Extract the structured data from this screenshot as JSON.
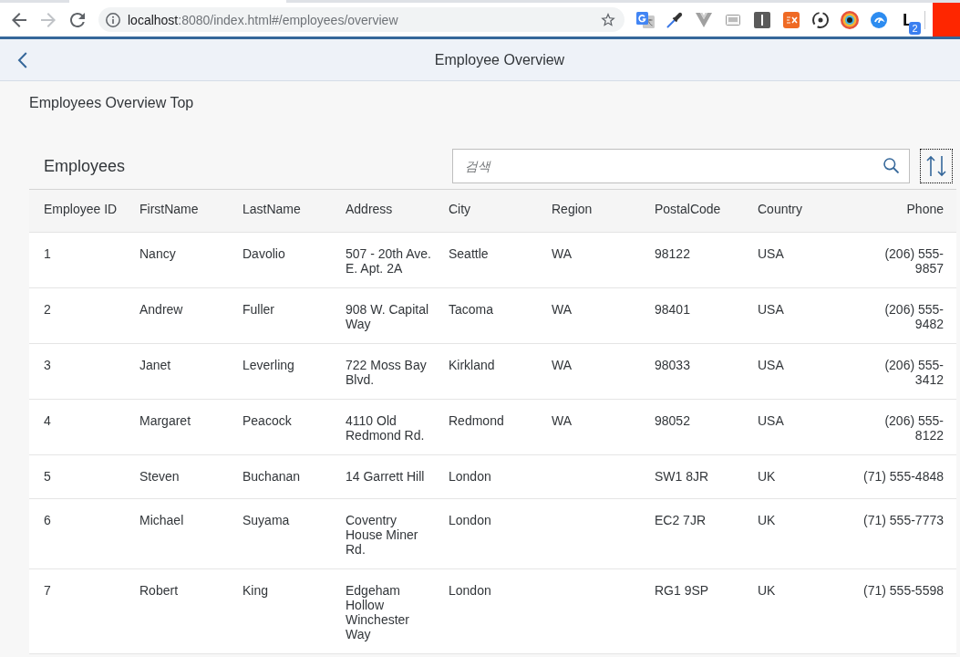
{
  "browser": {
    "nav": [
      {
        "kind": "back",
        "disabled": false
      },
      {
        "kind": "forward",
        "disabled": true
      },
      {
        "kind": "reload",
        "disabled": false
      }
    ],
    "url": {
      "host": "localhost",
      "path": ":8080/index.html#/employees/overview"
    },
    "extensions": [
      {
        "kind": "translate"
      },
      {
        "kind": "dropper"
      },
      {
        "kind": "vee"
      },
      {
        "kind": "screen"
      },
      {
        "kind": "bar"
      },
      {
        "kind": "ex"
      },
      {
        "kind": "sync"
      },
      {
        "kind": "ring"
      },
      {
        "kind": "swirl"
      },
      {
        "kind": "letter",
        "label": "L",
        "badge": "2"
      }
    ]
  },
  "header": {
    "title": "Employee Overview"
  },
  "page": {
    "heading": "Employees Overview Top"
  },
  "table": {
    "title": "Employees",
    "search": {
      "placeholder": "검색"
    },
    "sort_button": {
      "focused": true
    },
    "columns": [
      {
        "label": "Employee ID",
        "kind": "text"
      },
      {
        "label": "FirstName",
        "kind": "text"
      },
      {
        "label": "LastName",
        "kind": "text"
      },
      {
        "label": "Address",
        "kind": "text"
      },
      {
        "label": "City",
        "kind": "text"
      },
      {
        "label": "Region",
        "kind": "text"
      },
      {
        "label": "PostalCode",
        "kind": "text"
      },
      {
        "label": "Country",
        "kind": "text"
      },
      {
        "label": "Phone",
        "kind": "phone"
      }
    ],
    "rows": [
      {
        "id": "1",
        "first_name": "Nancy",
        "last_name": "Davolio",
        "address": "507 - 20th Ave. E. Apt. 2A",
        "city": "Seattle",
        "region": "WA",
        "postal_code": "98122",
        "country": "USA",
        "phone": "(206) 555-9857"
      },
      {
        "id": "2",
        "first_name": "Andrew",
        "last_name": "Fuller",
        "address": "908 W. Capital Way",
        "city": "Tacoma",
        "region": "WA",
        "postal_code": "98401",
        "country": "USA",
        "phone": "(206) 555-9482"
      },
      {
        "id": "3",
        "first_name": "Janet",
        "last_name": "Leverling",
        "address": "722 Moss Bay Blvd.",
        "city": "Kirkland",
        "region": "WA",
        "postal_code": "98033",
        "country": "USA",
        "phone": "(206) 555-3412"
      },
      {
        "id": "4",
        "first_name": "Margaret",
        "last_name": "Peacock",
        "address": "4110 Old Redmond Rd.",
        "city": "Redmond",
        "region": "WA",
        "postal_code": "98052",
        "country": "USA",
        "phone": "(206) 555-8122"
      },
      {
        "id": "5",
        "first_name": "Steven",
        "last_name": "Buchanan",
        "address": "14 Garrett Hill",
        "city": "London",
        "postal_code": "SW1 8JR",
        "country": "UK",
        "phone": "(71) 555-4848"
      },
      {
        "id": "6",
        "first_name": "Michael",
        "last_name": "Suyama",
        "address": "Coventry House Miner Rd.",
        "city": "London",
        "postal_code": "EC2 7JR",
        "country": "UK",
        "phone": "(71) 555-7773"
      },
      {
        "id": "7",
        "first_name": "Robert",
        "last_name": "King",
        "address": "Edgeham Hollow Winchester Way",
        "city": "London",
        "postal_code": "RG1 9SP",
        "country": "UK",
        "phone": "(71) 555-5598"
      }
    ]
  }
}
